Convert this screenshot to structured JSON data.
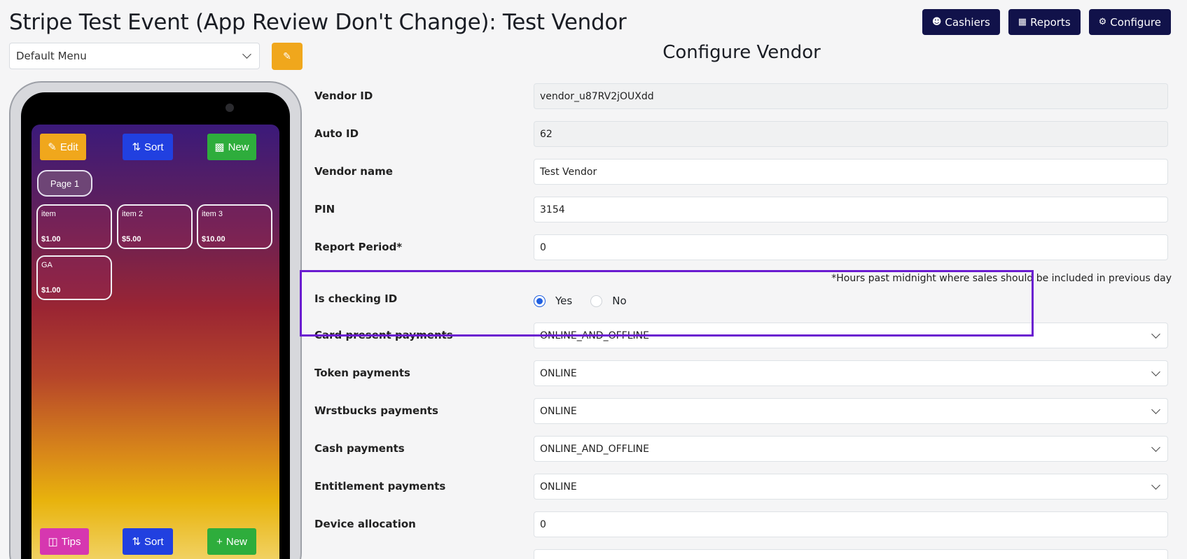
{
  "header": {
    "title": "Stripe Test Event (App Review Don't Change): Test Vendor",
    "buttons": [
      {
        "label": "Cashiers",
        "icon": "person-icon"
      },
      {
        "label": "Reports",
        "icon": "bar-chart-icon"
      },
      {
        "label": "Configure",
        "icon": "gear-icon"
      }
    ]
  },
  "menu_select": {
    "value": "Default Menu"
  },
  "phone": {
    "top_buttons": {
      "edit": "Edit",
      "sort": "Sort",
      "new": "New"
    },
    "page_tab": "Page 1",
    "items": [
      {
        "name": "item",
        "price": "$1.00"
      },
      {
        "name": "item 2",
        "price": "$5.00"
      },
      {
        "name": "item 3",
        "price": "$10.00"
      },
      {
        "name": "GA",
        "price": "$1.00"
      }
    ],
    "bottom_buttons": {
      "tips": "Tips",
      "sort": "Sort",
      "new": "New"
    }
  },
  "form": {
    "title": "Configure Vendor",
    "vendor_id": {
      "label": "Vendor ID",
      "value": "vendor_u87RV2jOUXdd"
    },
    "auto_id": {
      "label": "Auto ID",
      "value": "62"
    },
    "vendor_name": {
      "label": "Vendor name",
      "value": "Test Vendor"
    },
    "pin": {
      "label": "PIN",
      "value": "3154"
    },
    "report_period": {
      "label": "Report Period*",
      "value": "0",
      "hint": "*Hours past midnight where sales should be included in previous day"
    },
    "checking_id": {
      "label": "Is checking ID",
      "yes": "Yes",
      "no": "No",
      "selected": "Yes"
    },
    "card_present": {
      "label": "Card present payments",
      "value": "ONLINE_AND_OFFLINE"
    },
    "token": {
      "label": "Token payments",
      "value": "ONLINE"
    },
    "wrstbucks": {
      "label": "Wrstbucks payments",
      "value": "ONLINE"
    },
    "cash": {
      "label": "Cash payments",
      "value": "ONLINE_AND_OFFLINE"
    },
    "entitlement": {
      "label": "Entitlement payments",
      "value": "ONLINE"
    },
    "device_allocation": {
      "label": "Device allocation",
      "value": "0"
    }
  },
  "colors": {
    "navy": "#11124a",
    "highlight": "#6a1bd0",
    "accent_orange": "#f0a71c"
  }
}
